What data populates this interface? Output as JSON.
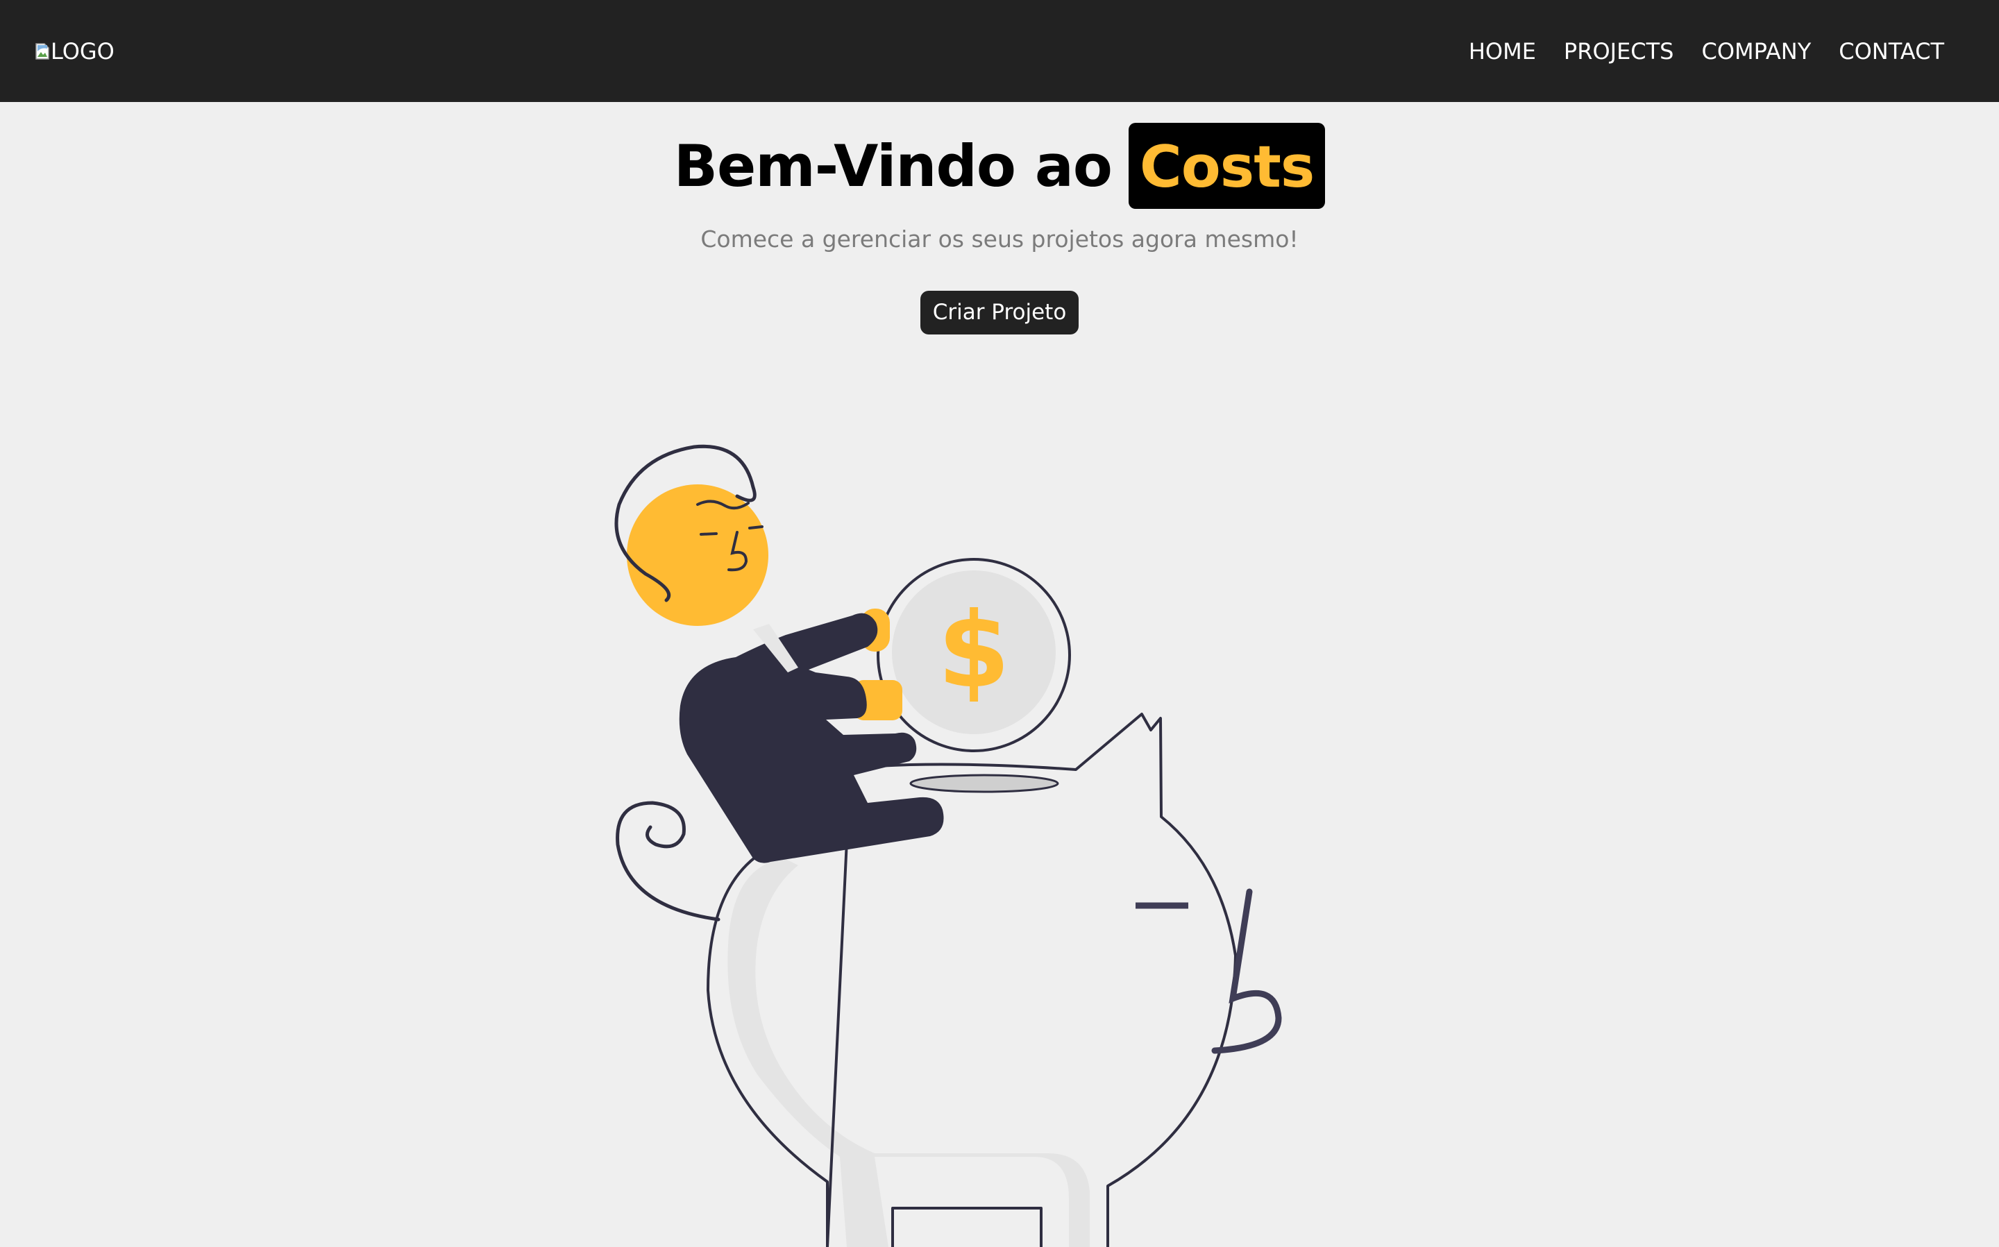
{
  "navbar": {
    "logo_alt": "LOGO",
    "links": [
      "HOME",
      "PROJECTS",
      "COMPANY",
      "CONTACT"
    ]
  },
  "hero": {
    "title_prefix": "Bem-Vindo ao",
    "title_brand": "Costs",
    "subtitle": "Comece a gerenciar os seus projetos agora mesmo!",
    "cta_label": "Criar Projeto"
  },
  "illustration": {
    "coin_symbol": "$",
    "icon": "piggy-bank-savings-illustration"
  },
  "colors": {
    "navbar_bg": "#222222",
    "page_bg": "#efefef",
    "accent": "#FFBB33",
    "dark_figure": "#2f2e41"
  }
}
